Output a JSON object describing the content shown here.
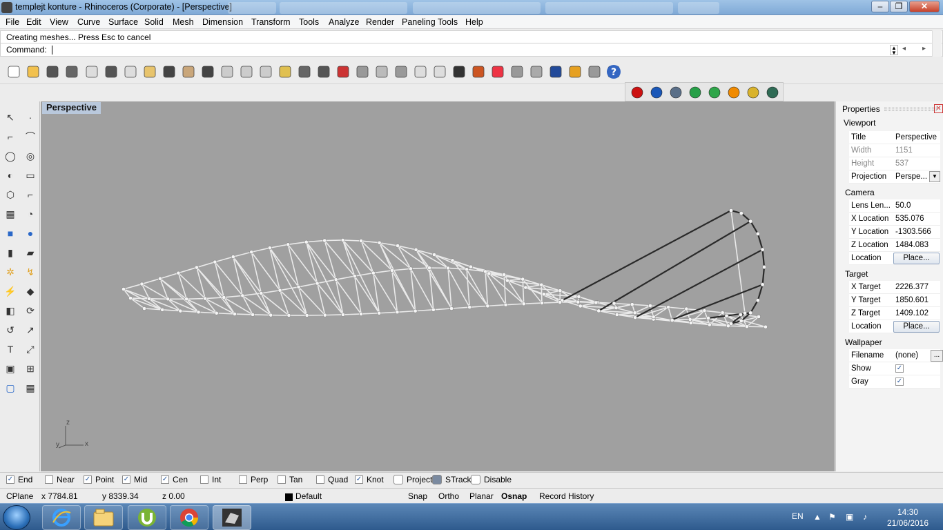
{
  "window": {
    "title": "templejt konture - Rhinoceros (Corporate) - [Perspective]",
    "buttons": {
      "minimize": "–",
      "maximize": "❐",
      "close": "✕"
    }
  },
  "menu": [
    "File",
    "Edit",
    "View",
    "Curve",
    "Surface",
    "Solid",
    "Mesh",
    "Dimension",
    "Transform",
    "Tools",
    "Analyze",
    "Render",
    "Paneling Tools",
    "Help"
  ],
  "command": {
    "history": "Creating meshes... Press Esc to cancel",
    "prompt": "Command:",
    "value": ""
  },
  "toolbar_icons": [
    "new-file",
    "open-file",
    "save",
    "print",
    "import",
    "cut",
    "copy",
    "paste",
    "undo",
    "pan",
    "move",
    "zoom-window",
    "zoom-dynamic",
    "zoom-extents",
    "zoom-selected",
    "rotate-view",
    "four-viewports",
    "car",
    "grid-plane",
    "cplane",
    "osnap",
    "light-bulb",
    "light",
    "lock",
    "material",
    "color-wheel",
    "sphere-wireframe",
    "sphere-mesh",
    "sphere-render",
    "pointer",
    "gear",
    "options",
    "help"
  ],
  "toolbar2_icons": [
    "red-render-sphere",
    "blue-render-sphere",
    "box-wireframe",
    "green-gem",
    "green-shield",
    "cone",
    "square-select",
    "book"
  ],
  "left_tool_icons": [
    "select",
    "point",
    "polyline",
    "curve-from-points",
    "circle",
    "ellipse",
    "arc",
    "rectangle",
    "polygon",
    "fillet-curve",
    "surface-from-points",
    "revolve",
    "box",
    "sphere",
    "cylinder",
    "extrude",
    "gears",
    "explode",
    "paint",
    "boolean",
    "solid-tools",
    "offset",
    "bend",
    "rotate",
    "text",
    "dimension",
    "block",
    "array",
    "box-3d",
    "grid"
  ],
  "viewport": {
    "label": "Perspective",
    "axes": {
      "z": "z",
      "y": "y",
      "x": "x"
    },
    "background": "#a0a0a0"
  },
  "properties": {
    "title": "Properties",
    "close": "✕",
    "sections": {
      "viewport": "Viewport",
      "camera": "Camera",
      "target": "Target",
      "wallpaper": "Wallpaper"
    },
    "viewport_rows": [
      {
        "key": "Title",
        "value": "Perspective",
        "dim": false
      },
      {
        "key": "Width",
        "value": "1151",
        "dim": true
      },
      {
        "key": "Height",
        "value": "537",
        "dim": true
      },
      {
        "key": "Projection",
        "value": "Perspe...",
        "dim": false
      }
    ],
    "camera_rows": [
      {
        "key": "Lens Len...",
        "value": "50.0"
      },
      {
        "key": "X Location",
        "value": "535.076"
      },
      {
        "key": "Y Location",
        "value": "-1303.566"
      },
      {
        "key": "Z Location",
        "value": "1484.083"
      },
      {
        "key": "Location",
        "button": "Place..."
      }
    ],
    "target_rows": [
      {
        "key": "X Target",
        "value": "2226.377"
      },
      {
        "key": "Y Target",
        "value": "1850.601"
      },
      {
        "key": "Z Target",
        "value": "1409.102"
      },
      {
        "key": "Location",
        "button": "Place..."
      }
    ],
    "wallpaper_rows": [
      {
        "key": "Filename",
        "value": "(none)",
        "dots": "..."
      },
      {
        "key": "Show",
        "checked": true
      },
      {
        "key": "Gray",
        "checked": true
      }
    ]
  },
  "osnaps": [
    {
      "label": "End",
      "checked": true
    },
    {
      "label": "Near",
      "checked": false
    },
    {
      "label": "Point",
      "checked": true
    },
    {
      "label": "Mid",
      "checked": true
    },
    {
      "label": "Cen",
      "checked": true
    },
    {
      "label": "Int",
      "checked": false
    },
    {
      "label": "Perp",
      "checked": false
    },
    {
      "label": "Tan",
      "checked": false
    },
    {
      "label": "Quad",
      "checked": false
    },
    {
      "label": "Knot",
      "checked": true
    },
    {
      "label": "Project",
      "checked": false
    },
    {
      "label": "STrack",
      "checked": true
    },
    {
      "label": "Disable",
      "checked": false
    }
  ],
  "status": {
    "cplane": "CPlane",
    "x": "x 7784.81",
    "y": "y 8339.34",
    "z": "z 0.00",
    "layer": "Default",
    "snap": "Snap",
    "ortho": "Ortho",
    "planar": "Planar",
    "osnap": "Osnap",
    "record": "Record History"
  },
  "taskbar": {
    "apps": [
      "internet-explorer",
      "file-explorer",
      "utorrent",
      "chrome",
      "rhino"
    ],
    "language": "EN",
    "time": "14:30",
    "date": "21/06/2016"
  }
}
